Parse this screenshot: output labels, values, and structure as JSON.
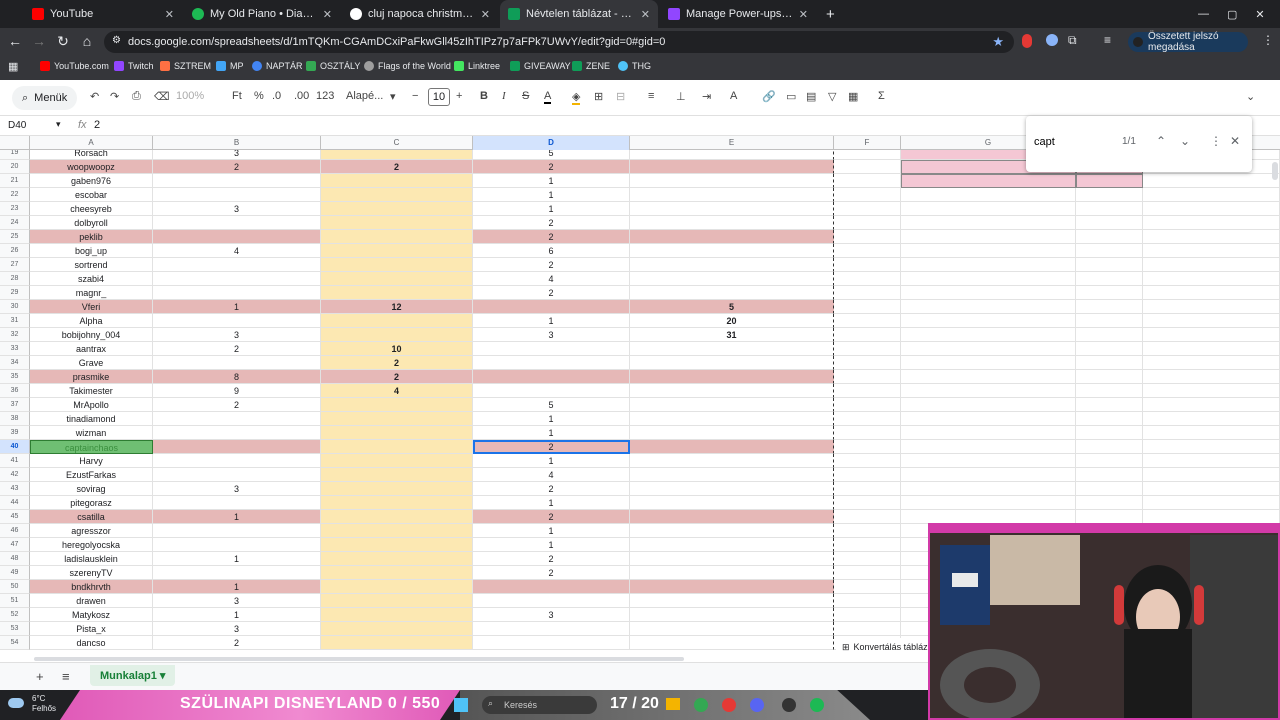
{
  "browser": {
    "tabs": [
      {
        "label": "YouTube",
        "icon": "youtube-icon",
        "color": "#ff0000",
        "active": false
      },
      {
        "label": "My Old Piano • Diana Ross",
        "icon": "spotify-icon",
        "color": "#1db954",
        "active": false
      },
      {
        "label": "cluj napoca christmas - Google",
        "icon": "google-icon",
        "color": "#ffffff",
        "active": false
      },
      {
        "label": "Névtelen táblázat - Google Tábl",
        "icon": "sheets-icon",
        "color": "#0f9d58",
        "active": true
      },
      {
        "label": "Manage Power-ups & Channel",
        "icon": "twitch-icon",
        "color": "#9146ff",
        "active": false
      }
    ],
    "url": "docs.google.com/spreadsheets/d/1mTQKm-CGAmDCxiPaFkwGll45zIhTIPz7p7aFPk7UWvY/edit?gid=0#gid=0",
    "password_button": "Összetett jelszó megadása",
    "bookmarks": [
      {
        "label": "YouTube.com",
        "icon": "youtube-icon"
      },
      {
        "label": "Twitch",
        "icon": "twitch-icon"
      },
      {
        "label": "SZTREM",
        "icon": "sztrem-icon"
      },
      {
        "label": "MP",
        "icon": "mp-icon"
      },
      {
        "label": "NAPTÁR",
        "icon": "calendar-icon"
      },
      {
        "label": "OSZTÁLY",
        "icon": "class-icon"
      },
      {
        "label": "Flags of the World",
        "icon": "globe-icon"
      },
      {
        "label": "Linktree",
        "icon": "linktree-icon"
      },
      {
        "label": "GIVEAWAY",
        "icon": "giveaway-icon"
      },
      {
        "label": "ZENE",
        "icon": "music-icon"
      },
      {
        "label": "THG",
        "icon": "thg-icon"
      }
    ]
  },
  "toolbar": {
    "menus_label": "Menük",
    "zoom": "100%",
    "currency": "Ft",
    "percent": "%",
    "dec_decrease": ".0",
    "dec_increase": ".00",
    "number_format": "123",
    "font": "Alapé...",
    "font_size": "10"
  },
  "formula": {
    "cell": "D40",
    "fx": "fx",
    "value": "2"
  },
  "find": {
    "query": "capt",
    "count": "1/1"
  },
  "columns": [
    "A",
    "B",
    "C",
    "D",
    "E",
    "F",
    "G",
    "H"
  ],
  "rows": [
    {
      "n": "19",
      "a": "Rorsach",
      "b": "3",
      "c": "",
      "d": "5",
      "e": "",
      "pink": false
    },
    {
      "n": "20",
      "a": "woopwoopz",
      "b": "2",
      "c": "2",
      "d": "2",
      "e": "",
      "pink": true
    },
    {
      "n": "21",
      "a": "gaben976",
      "b": "",
      "c": "",
      "d": "1",
      "e": "",
      "pink": false
    },
    {
      "n": "22",
      "a": "escobar",
      "b": "",
      "c": "",
      "d": "1",
      "e": "",
      "pink": false
    },
    {
      "n": "23",
      "a": "cheesyreb",
      "b": "3",
      "c": "",
      "d": "1",
      "e": "",
      "pink": false
    },
    {
      "n": "24",
      "a": "dolbyroll",
      "b": "",
      "c": "",
      "d": "2",
      "e": "",
      "pink": false
    },
    {
      "n": "25",
      "a": "peklib",
      "b": "",
      "c": "",
      "d": "2",
      "e": "",
      "pink": true
    },
    {
      "n": "26",
      "a": "bogi_up",
      "b": "4",
      "c": "",
      "d": "6",
      "e": "",
      "pink": false
    },
    {
      "n": "27",
      "a": "sortrend",
      "b": "",
      "c": "",
      "d": "2",
      "e": "",
      "pink": false
    },
    {
      "n": "28",
      "a": "szabi4",
      "b": "",
      "c": "",
      "d": "4",
      "e": "",
      "pink": false
    },
    {
      "n": "29",
      "a": "magnr_",
      "b": "",
      "c": "",
      "d": "2",
      "e": "",
      "pink": false
    },
    {
      "n": "30",
      "a": "Vferi",
      "b": "1",
      "c": "12",
      "d": "",
      "e": "5",
      "pink": true
    },
    {
      "n": "31",
      "a": "Alpha",
      "b": "",
      "c": "",
      "d": "1",
      "e": "20",
      "pink": false
    },
    {
      "n": "32",
      "a": "bobijohny_004",
      "b": "3",
      "c": "",
      "d": "3",
      "e": "31",
      "pink": false
    },
    {
      "n": "33",
      "a": "aantrax",
      "b": "2",
      "c": "10",
      "d": "",
      "e": "",
      "pink": false
    },
    {
      "n": "34",
      "a": "Grave",
      "b": "",
      "c": "2",
      "d": "",
      "e": "",
      "pink": false
    },
    {
      "n": "35",
      "a": "prasmike",
      "b": "8",
      "c": "2",
      "d": "",
      "e": "",
      "pink": true
    },
    {
      "n": "36",
      "a": "Takimester",
      "b": "9",
      "c": "4",
      "d": "",
      "e": "",
      "pink": false
    },
    {
      "n": "37",
      "a": "MrApollo",
      "b": "2",
      "c": "",
      "d": "5",
      "e": "",
      "pink": false
    },
    {
      "n": "38",
      "a": "tinadiamond",
      "b": "",
      "c": "",
      "d": "1",
      "e": "",
      "pink": false
    },
    {
      "n": "39",
      "a": "wizman",
      "b": "",
      "c": "",
      "d": "1",
      "e": "",
      "pink": false
    },
    {
      "n": "40",
      "a": "captainchaos",
      "b": "",
      "c": "",
      "d": "2",
      "e": "",
      "pink": true,
      "found": true
    },
    {
      "n": "41",
      "a": "Harvy",
      "b": "",
      "c": "",
      "d": "1",
      "e": "",
      "pink": false
    },
    {
      "n": "42",
      "a": "EzustFarkas",
      "b": "",
      "c": "",
      "d": "4",
      "e": "",
      "pink": false
    },
    {
      "n": "43",
      "a": "sovirag",
      "b": "3",
      "c": "",
      "d": "2",
      "e": "",
      "pink": false
    },
    {
      "n": "44",
      "a": "pitegorasz",
      "b": "",
      "c": "",
      "d": "1",
      "e": "",
      "pink": false
    },
    {
      "n": "45",
      "a": "csatilla",
      "b": "1",
      "c": "",
      "d": "2",
      "e": "",
      "pink": true
    },
    {
      "n": "46",
      "a": "agresszor",
      "b": "",
      "c": "",
      "d": "1",
      "e": "",
      "pink": false
    },
    {
      "n": "47",
      "a": "heregolyocska",
      "b": "",
      "c": "",
      "d": "1",
      "e": "",
      "pink": false
    },
    {
      "n": "48",
      "a": "ladislausklein",
      "b": "1",
      "c": "",
      "d": "2",
      "e": "",
      "pink": false
    },
    {
      "n": "49",
      "a": "szerenyTV",
      "b": "",
      "c": "",
      "d": "2",
      "e": "",
      "pink": false
    },
    {
      "n": "50",
      "a": "bndkhrvth",
      "b": "1",
      "c": "",
      "d": "",
      "e": "",
      "pink": true
    },
    {
      "n": "51",
      "a": "drawen",
      "b": "3",
      "c": "",
      "d": "",
      "e": "",
      "pink": false
    },
    {
      "n": "52",
      "a": "Matykosz",
      "b": "1",
      "c": "",
      "d": "3",
      "e": "",
      "pink": false
    },
    {
      "n": "53",
      "a": "Pista_x",
      "b": "3",
      "c": "",
      "d": "",
      "e": "",
      "pink": false
    },
    {
      "n": "54",
      "a": "dancso",
      "b": "2",
      "c": "",
      "d": "",
      "e": "",
      "pink": false
    }
  ],
  "sheet": {
    "tab": "Munkalap1",
    "convert_label": "Konvertálás tábláz"
  },
  "taskbar": {
    "temperature": "6°C",
    "weather": "Felhős",
    "banner_text": "SZÜLINAPI DISNEYLAND  0  /  550",
    "search_placeholder": "Keresés",
    "counter": "17 / 20"
  },
  "colors": {
    "pink": "#e6b8b7",
    "yellow": "#fce8b2",
    "selection": "#1a73e8",
    "overlay": "#e05ab8"
  }
}
